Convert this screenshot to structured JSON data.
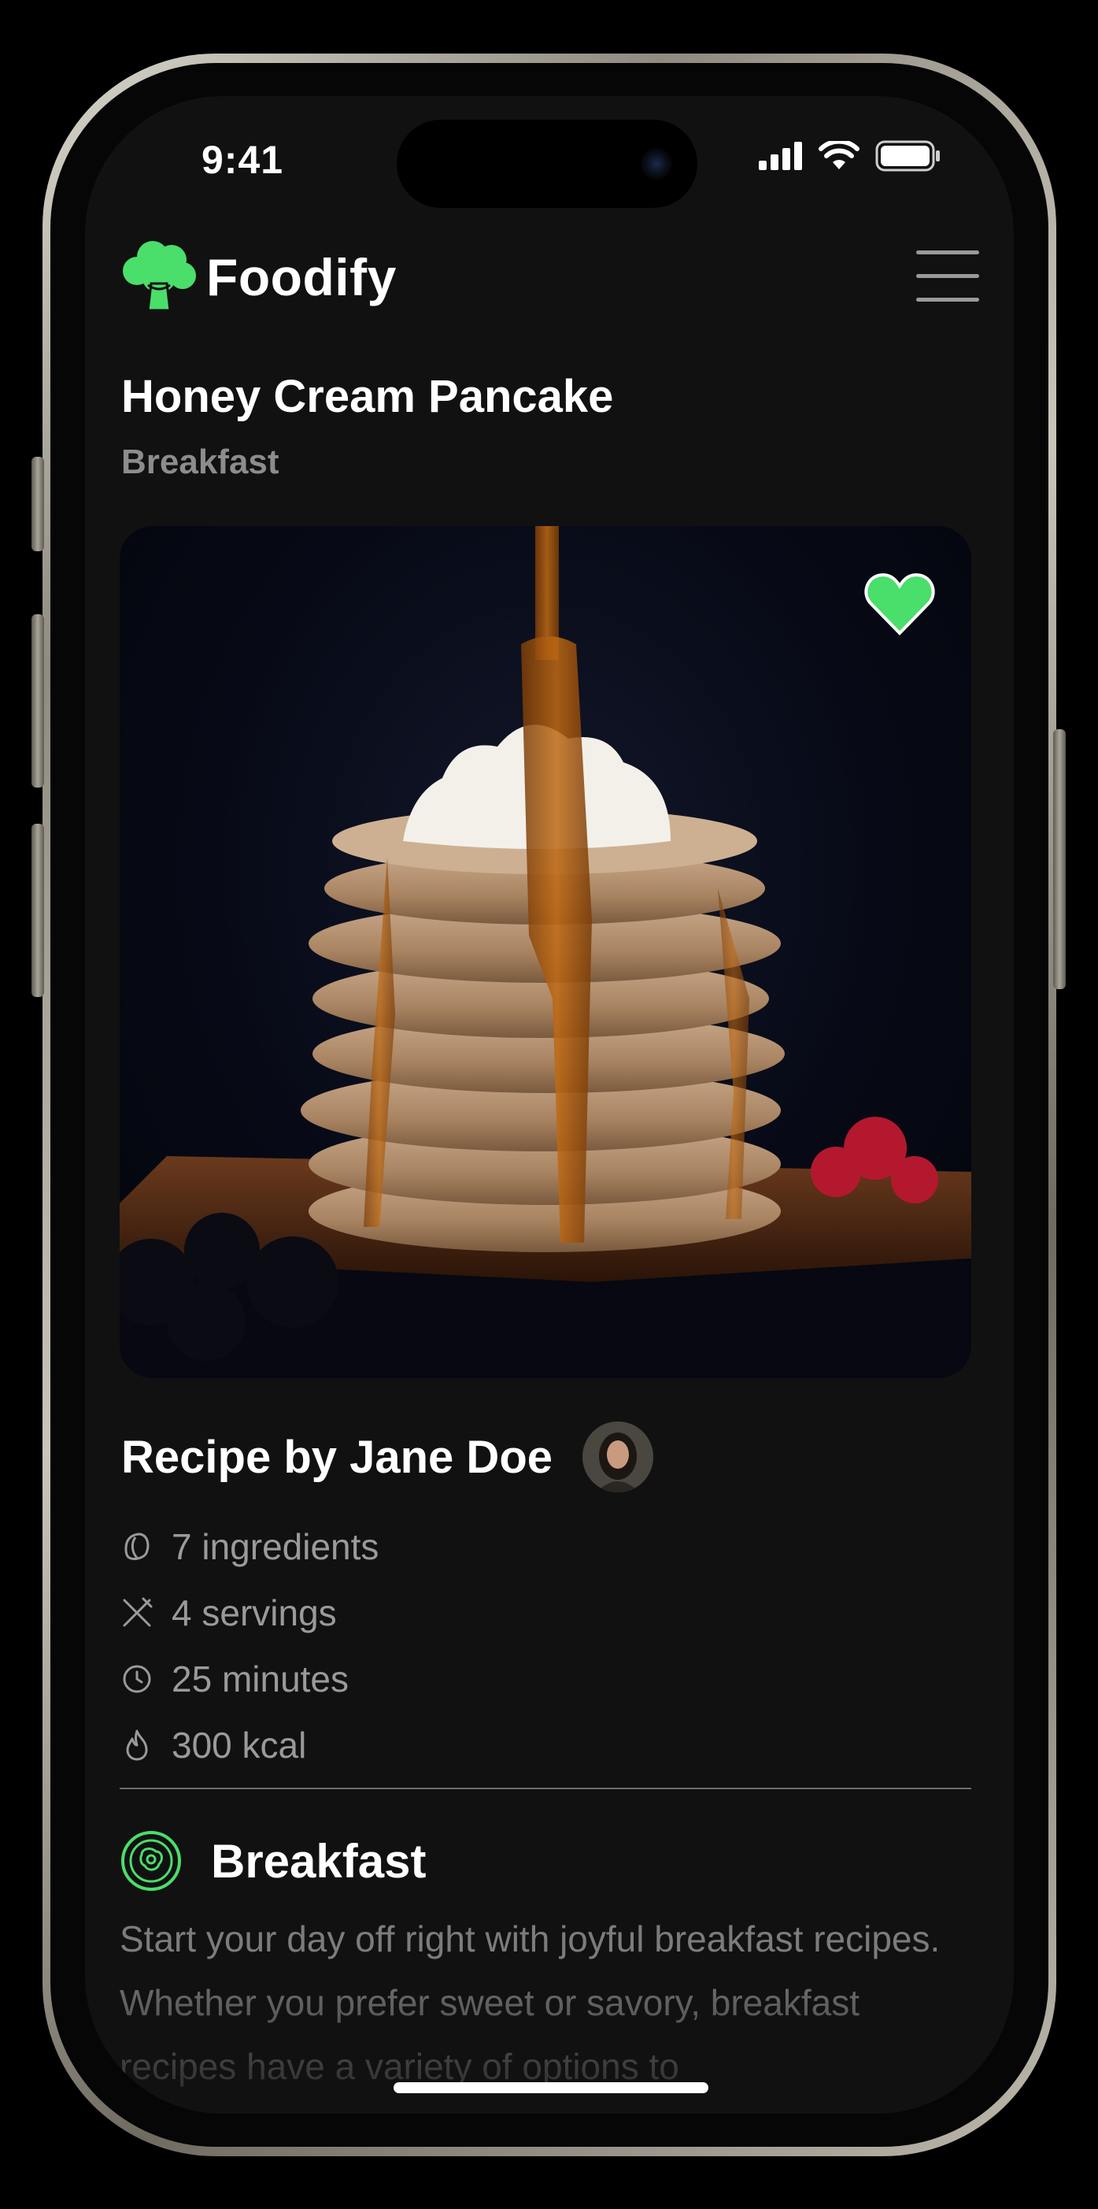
{
  "status_bar": {
    "time": "9:41"
  },
  "header": {
    "app_name": "Foodify"
  },
  "recipe": {
    "title": "Honey Cream Pancake",
    "category": "Breakfast",
    "author_line": "Recipe by Jane Doe",
    "meta": [
      {
        "icon": "ingredients-icon",
        "label": "7 ingredients"
      },
      {
        "icon": "servings-icon",
        "label": "4 servings"
      },
      {
        "icon": "clock-icon",
        "label": "25 minutes"
      },
      {
        "icon": "flame-icon",
        "label": "300 kcal"
      }
    ]
  },
  "section": {
    "title": "Breakfast",
    "body": "Start your day off right with joyful breakfast recipes. Whether you prefer sweet or savory, breakfast recipes have a variety of options to"
  },
  "colors": {
    "accent": "#4ade6a",
    "background": "#111111",
    "muted_text": "#9a9a9a"
  }
}
